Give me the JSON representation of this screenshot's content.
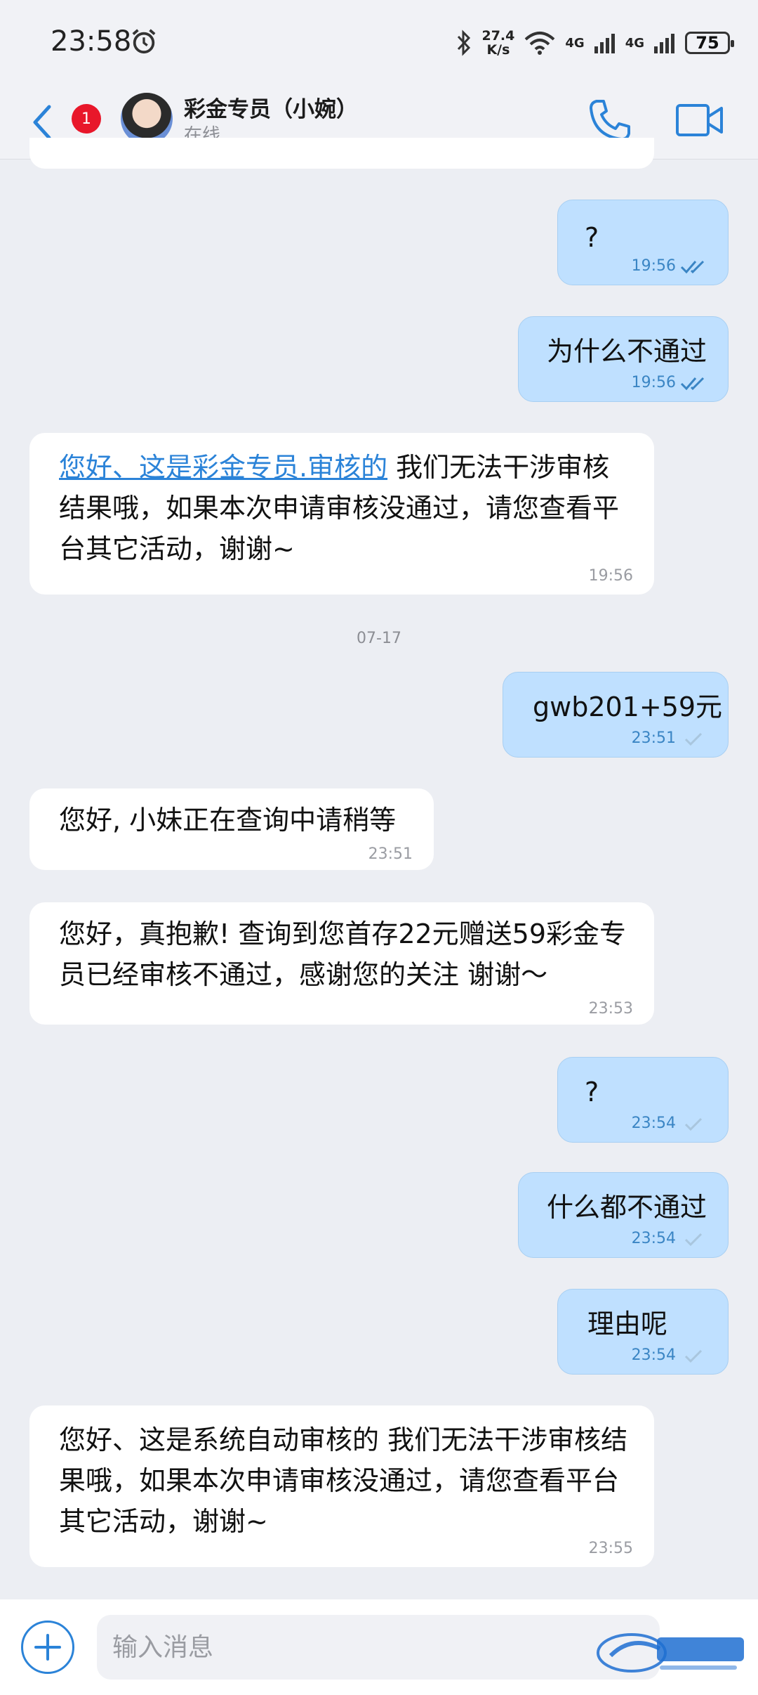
{
  "status_bar": {
    "time": "23:58",
    "net_speed_value": "27.4",
    "net_speed_unit": "K/s",
    "signal1": "4G",
    "signal2": "4G",
    "battery": "75"
  },
  "header": {
    "unread_count": "1",
    "contact_name": "彩金专员（小婉）",
    "contact_status": "在线"
  },
  "messages": [
    {
      "dir": "out",
      "text": "?",
      "time": "19:56",
      "status": "read"
    },
    {
      "dir": "out",
      "text": "为什么不通过",
      "time": "19:56",
      "status": "read"
    },
    {
      "dir": "in",
      "link": "您好、这是彩金专员.审核的",
      "text": " 我们无法干涉审核结果哦，如果本次申请审核没通过，请您查看平台其它活动，谢谢~",
      "time": "19:56"
    },
    {
      "dir": "out",
      "text": "gwb201+59元",
      "time": "23:51",
      "status": "sent"
    },
    {
      "dir": "in",
      "text": "您好, 小妹正在查询中请稍等",
      "time": "23:51"
    },
    {
      "dir": "in",
      "text": "您好，真抱歉! 查询到您首存22元赠送59彩金专员已经审核不通过，感谢您的关注 谢谢～",
      "time": "23:53"
    },
    {
      "dir": "out",
      "text": "?",
      "time": "23:54",
      "status": "sent"
    },
    {
      "dir": "out",
      "text": "什么都不通过",
      "time": "23:54",
      "status": "sent"
    },
    {
      "dir": "out",
      "text": "理由呢",
      "time": "23:54",
      "status": "sent"
    },
    {
      "dir": "in",
      "text": "您好、这是系统自动审核的 我们无法干涉审核结果哦，如果本次申请审核没通过，请您查看平台其它活动，谢谢~",
      "time": "23:55"
    }
  ],
  "date_separator": "07-17",
  "input": {
    "placeholder": "输入消息"
  },
  "colors": {
    "accent": "#2b83d8",
    "outgoing_bubble": "#bfe0ff",
    "badge": "#e8172a"
  }
}
